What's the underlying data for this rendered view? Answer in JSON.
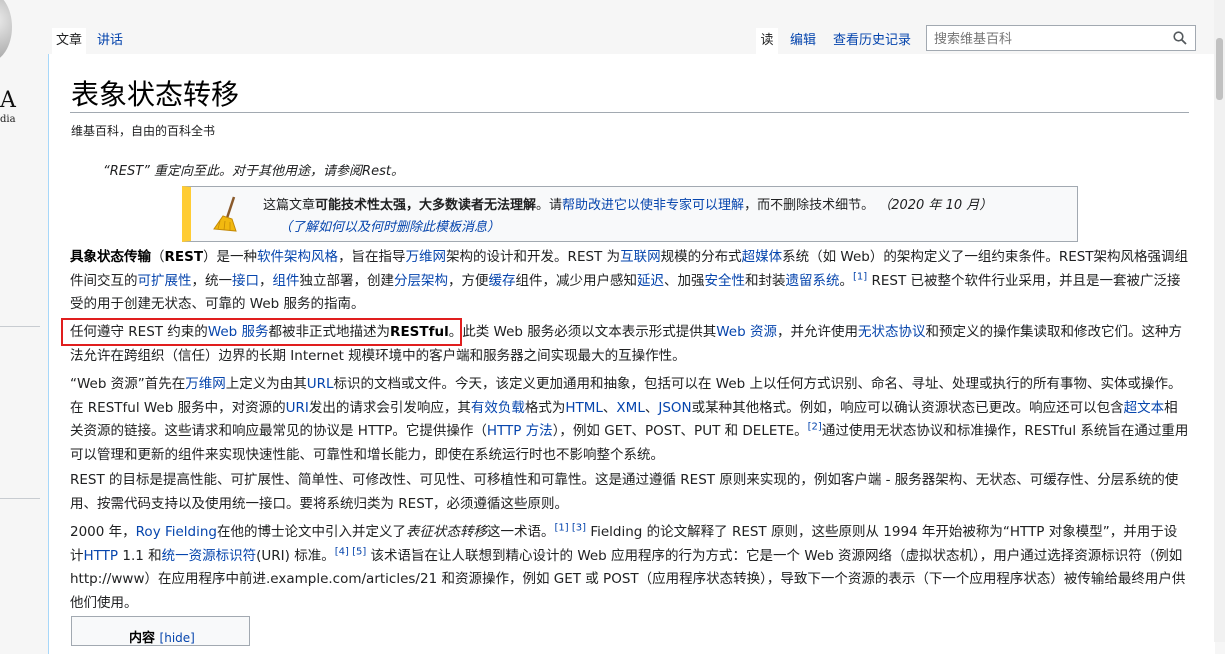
{
  "logo": {
    "wordmark": "A",
    "tagline": "dia"
  },
  "tabs": {
    "article": "文章",
    "talk": "讲话",
    "read": "读",
    "edit": "编辑",
    "history": "查看历史记录"
  },
  "search": {
    "placeholder": "搜索维基百科"
  },
  "page": {
    "title": "表象状态转移",
    "tagline": "维基百科，自由的百科全书",
    "hatnote": "“REST” 重定向至此。对于其他用途，请参阅Rest。"
  },
  "ambox": {
    "p1": "这篇文章",
    "p2": "可能技术性太强，大多数读者无法理解",
    "p3": "。请",
    "p4": "帮助改进它以使非专家可以理解",
    "p5": "，而不删除技术细节。",
    "date": "（2020 年 10 月）",
    "help": "（了解如何以及何时删除此模板消息）"
  },
  "para1": {
    "t1": "具象状态传输",
    "t2": "（",
    "t3": "REST",
    "t4": "）是一种",
    "l1": "软件架构风格",
    "t5": "，旨在指导",
    "l2": "万维网",
    "t6": "架构的设计和开发。REST 为",
    "l3": "互联网",
    "t7": "规模的分布式",
    "l4": "超媒体",
    "t8": "系统（如 Web）的架构定义了一组约束条件。REST架构风格强调组件间交互的",
    "l5": "可扩展性",
    "t9": "，统一",
    "l6": "接口",
    "t10": "，",
    "l7": "组件",
    "t11": "独立部署，创建",
    "l8": "分层架构",
    "t12": "，方便",
    "l9": "缓存",
    "t13": "组件，减少用户感知",
    "l10": "延迟",
    "t14": "、加强",
    "l11": "安全性",
    "t15": "和封装",
    "l12": "遗留系统",
    "t16": "。",
    "ref": "[1]",
    "t17": " REST 已被整个软件行业采用，并且是一套被广泛接受的用于创建无状态、可靠的 Web 服务的指南。"
  },
  "para2": {
    "t1": "任何遵守 REST 约束的",
    "l1": "Web 服务",
    "t2": "都被非正式地描述为",
    "t3": "RESTful",
    "t4": "。此类 Web 服务必须以文本表示形式提供其",
    "l2": "Web 资源",
    "t5": "，并允许使用",
    "l3": "无状态协议",
    "t6": "和预定义的操作集读取和修改它们。这种方法允许在跨组织（信任）边界的长期 Internet 规模环境中的客户端和服务器之间实现最大的互操作性。"
  },
  "para3": {
    "t1": "“Web 资源”首先在",
    "l1": "万维网",
    "t2": "上定义为由其",
    "l2": "URL",
    "t3": "标识的文档或文件。今天，该定义更加通用和抽象，包括可以在 Web 上以任何方式识别、命名、寻址、处理或执行的所有事物、实体或操作。在 RESTful Web 服务中，对资源的",
    "l3": "URI",
    "t4": "发出的请求会引发响应，其",
    "l4": "有效负载",
    "t5": "格式为",
    "l5": "HTML",
    "t6": "、",
    "l6": "XML",
    "t7": "、",
    "l7": "JSON",
    "t8": "或某种其他格式。例如，响应可以确认资源状态已更改。响应还可以包含",
    "l8": "超文本",
    "t9": "相关资源的链接。这些请求和响应最常见的协议是 HTTP。它提供操作（",
    "l9": "HTTP 方法",
    "t10": "），例如 GET、POST、PUT 和 DELETE。",
    "ref": "[2]",
    "t11": "通过使用无状态协议和标准操作，RESTful 系统旨在通过重用可以管理和更新的组件来实现快速性能、可靠性和增长能力，即使在系统运行时也不影响整个系统。"
  },
  "para4": {
    "t1": "REST 的目标是提高性能、可扩展性、简单性、可修改性、可见性、可移植性和可靠性。这是通过遵循 REST 原则来实现的，例如客户端 - 服务器架构、无状态、可缓存性、分层系统的使用、按需代码支持以及使用统一接口。要将系统归类为 REST，必须遵循这些原则。"
  },
  "para5": {
    "t1": "2000 年，",
    "l1": "Roy Fielding",
    "t2": "在他的博士论文中引入并定义了",
    "t3": "表征状态转移",
    "t4": "这一术语。",
    "ref1": "[1]",
    "ref2": "[3]",
    "t5": " Fielding 的论文解释了 REST 原则，这些原则从 1994 年开始被称为“HTTP 对象模型”，并用于设计",
    "l2": "HTTP",
    "t6": " 1.1 和",
    "l3": "统一资源标识符",
    "t7": "(URI) 标准。",
    "ref3": "[4]",
    "ref4": "[5]",
    "t8": " 该术语旨在让人联想到精心设计的 Web 应用程序的行为方式：它是一个 Web 资源网络（虚拟状态机），用户通过选择资源标识符（例如 http://www）在应用程序中前进.example.com/articles/21 和资源操作，例如 GET 或 POST（应用程序状态转换），导致下一个资源的表示（下一个应用程序状态）被传输给最终用户供他们使用。"
  },
  "toc": {
    "title": "内容",
    "hide": "[hide]"
  }
}
